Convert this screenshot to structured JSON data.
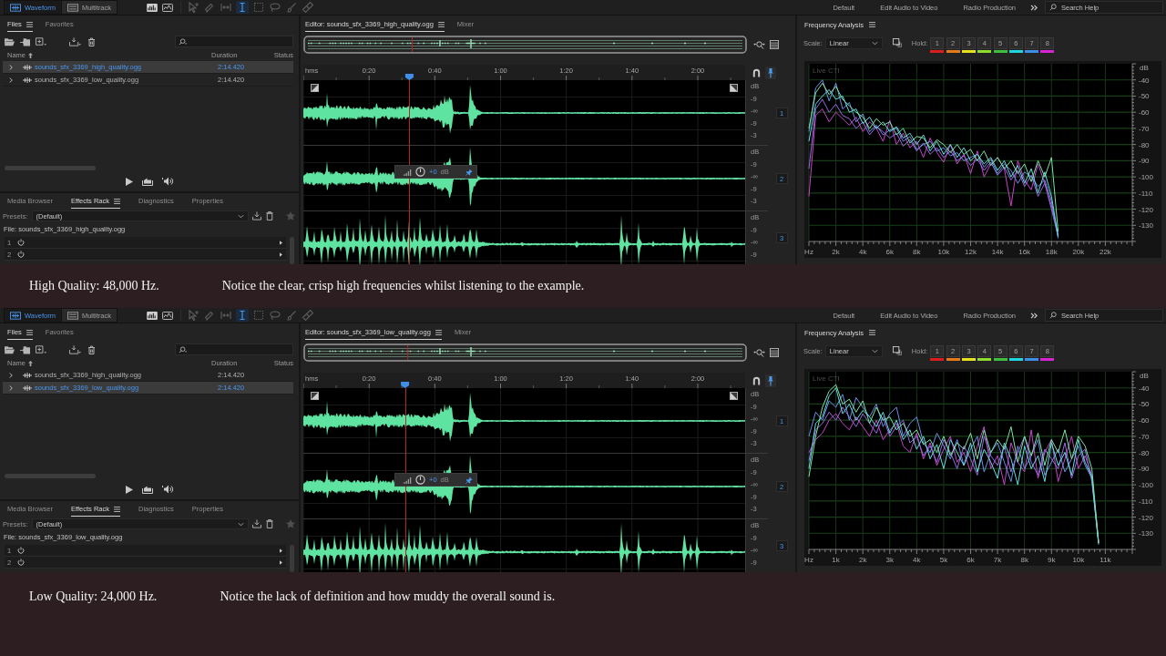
{
  "screens": [
    {
      "app_bar": {
        "modes": [
          {
            "label": "Waveform",
            "selected": true
          },
          {
            "label": "Multitrack",
            "selected": false
          }
        ],
        "tools": [
          {
            "kind": "move",
            "selected": false,
            "disabled": true
          },
          {
            "kind": "razor",
            "selected": false,
            "disabled": true
          },
          {
            "kind": "slip",
            "selected": false,
            "disabled": true
          },
          {
            "kind": "time",
            "selected": true,
            "disabled": false
          },
          {
            "kind": "marquee",
            "selected": false,
            "disabled": true
          },
          {
            "kind": "lasso",
            "selected": false,
            "disabled": true
          },
          {
            "kind": "brush",
            "selected": false,
            "disabled": true
          },
          {
            "kind": "heal",
            "selected": false,
            "disabled": true
          }
        ],
        "workspaces": [
          "Default",
          "Edit Audio to Video",
          "Radio Production"
        ],
        "search": {
          "placeholder": "Search Help"
        }
      },
      "files": {
        "tabs": [
          {
            "label": "Files",
            "selected": true
          },
          {
            "label": "Favorites",
            "selected": false
          }
        ],
        "columns": [
          "Name",
          "Duration",
          "Status"
        ],
        "rows": [
          {
            "name": "sounds_sfx_3369_high_quality.ogg",
            "duration": "2:14.420",
            "selected": true
          },
          {
            "name": "sounds_sfx_3369_low_quality.ogg",
            "duration": "2:14.420",
            "selected": false
          }
        ]
      },
      "effects": {
        "tabs": [
          {
            "label": "Media Browser",
            "selected": false
          },
          {
            "label": "Effects Rack",
            "selected": true
          },
          {
            "label": "Diagnostics",
            "selected": false
          },
          {
            "label": "Properties",
            "selected": false
          }
        ],
        "presets_label": "Presets:",
        "preset": "(Default)",
        "file": "File: sounds_sfx_3369_high_quality.ogg",
        "slots": [
          "1",
          "2"
        ]
      },
      "editor": {
        "tabs": [
          {
            "label": "Editor: sounds_sfx_3369_high_quality.ogg",
            "selected": true
          },
          {
            "label": "Mixer",
            "selected": false
          }
        ],
        "ruler": [
          "hms",
          "0:20",
          "0:40",
          "1:00",
          "1:20",
          "1:40",
          "2:00"
        ],
        "playhead": {
          "level": 0.24
        },
        "gain": {
          "value": "+0",
          "unit": "dB"
        },
        "channels": [
          {
            "scale": [
              "dB",
              "-9",
              "-∞",
              "-9",
              "-3"
            ],
            "number": "1"
          },
          {
            "scale": [
              "dB",
              "-9",
              "-∞",
              "-9",
              "-3"
            ],
            "number": "2"
          },
          {
            "scale": [
              "dB",
              "-9",
              "-∞",
              "-9"
            ],
            "number": "3"
          }
        ]
      },
      "frequency": {
        "title": "Frequency Analysis",
        "scale_label": "Scale:",
        "scale": "Linear",
        "hold_label": "Hold:",
        "holds": [
          {
            "label": "1",
            "color": "#d81e1e"
          },
          {
            "label": "2",
            "color": "#e57a1a"
          },
          {
            "label": "3",
            "color": "#e8e21e"
          },
          {
            "label": "4",
            "color": "#8edc2c"
          },
          {
            "label": "5",
            "color": "#3fbf3f"
          },
          {
            "label": "6",
            "color": "#1fd6e0"
          },
          {
            "label": "7",
            "color": "#3d8ee6"
          },
          {
            "label": "8",
            "color": "#d424d4"
          }
        ],
        "chart_data": [
          {
            "type": "line",
            "ylabel": "dB",
            "xlim": [
              0,
              24000
            ],
            "ylim": [
              -140,
              -30
            ],
            "xticks": [
              {
                "value": 0,
                "label": "Hz"
              },
              {
                "value": 2000,
                "label": "2k"
              },
              {
                "value": 4000,
                "label": "4k"
              },
              {
                "value": 6000,
                "label": "6k"
              },
              {
                "value": 8000,
                "label": "8k"
              },
              {
                "value": 10000,
                "label": "10k"
              },
              {
                "value": 12000,
                "label": "12k"
              },
              {
                "value": 14000,
                "label": "14k"
              },
              {
                "value": 16000,
                "label": "16k"
              },
              {
                "value": 18000,
                "label": "18k"
              },
              {
                "value": 20000,
                "label": "20k"
              },
              {
                "value": 22000,
                "label": "22k"
              }
            ],
            "yticks": [
              -40,
              -50,
              -60,
              -70,
              -80,
              -90,
              -100,
              -110,
              -120,
              -130
            ],
            "grid": true,
            "annotations": [
              "Live CTI"
            ],
            "x": [
              0,
              500,
              1000,
              1500,
              2000,
              2500,
              3000,
              3500,
              4000,
              4500,
              5000,
              5500,
              6000,
              6500,
              7000,
              7500,
              8000,
              8500,
              9000,
              9500,
              10000,
              10500,
              11000,
              11500,
              12000,
              12500,
              13000,
              13500,
              14000,
              14500,
              15000,
              15500,
              16000,
              16500,
              17000,
              17500,
              18000,
              18500
            ],
            "series": [
              {
                "color": "#c545c8",
                "values": [
                  -112,
                  -62,
                  -58,
                  -66,
                  -60,
                  -64,
                  -68,
                  -63,
                  -72,
                  -66,
                  -70,
                  -78,
                  -65,
                  -80,
                  -73,
                  -82,
                  -78,
                  -88,
                  -76,
                  -85,
                  -91,
                  -80,
                  -92,
                  -86,
                  -98,
                  -84,
                  -100,
                  -92,
                  -88,
                  -95,
                  -118,
                  -90,
                  -102,
                  -108,
                  -92,
                  -104,
                  -118,
                  -136
                ]
              },
              {
                "color": "#9a6ae6",
                "values": [
                  -95,
                  -58,
                  -52,
                  -60,
                  -55,
                  -62,
                  -64,
                  -70,
                  -66,
                  -74,
                  -69,
                  -72,
                  -76,
                  -73,
                  -81,
                  -77,
                  -84,
                  -79,
                  -86,
                  -82,
                  -88,
                  -84,
                  -90,
                  -87,
                  -93,
                  -89,
                  -96,
                  -91,
                  -99,
                  -94,
                  -102,
                  -96,
                  -106,
                  -99,
                  -112,
                  -104,
                  -120,
                  -137
                ]
              },
              {
                "color": "#6e8ee6",
                "values": [
                  -72,
                  -45,
                  -40,
                  -53,
                  -42,
                  -58,
                  -54,
                  -66,
                  -61,
                  -72,
                  -68,
                  -74,
                  -71,
                  -70,
                  -78,
                  -75,
                  -83,
                  -80,
                  -78,
                  -84,
                  -82,
                  -87,
                  -85,
                  -90,
                  -88,
                  -86,
                  -94,
                  -89,
                  -98,
                  -92,
                  -96,
                  -104,
                  -97,
                  -100,
                  -106,
                  -102,
                  -115,
                  -138
                ]
              },
              {
                "color": "#63dde3",
                "values": [
                  -78,
                  -55,
                  -50,
                  -46,
                  -52,
                  -50,
                  -60,
                  -58,
                  -67,
                  -63,
                  -70,
                  -66,
                  -72,
                  -69,
                  -76,
                  -73,
                  -80,
                  -74,
                  -84,
                  -78,
                  -86,
                  -80,
                  -88,
                  -82,
                  -90,
                  -86,
                  -92,
                  -88,
                  -96,
                  -90,
                  -100,
                  -93,
                  -104,
                  -95,
                  -110,
                  -97,
                  -112,
                  -137
                ]
              },
              {
                "color": "#7de3a6",
                "values": [
                  -70,
                  -48,
                  -42,
                  -49,
                  -44,
                  -52,
                  -56,
                  -60,
                  -63,
                  -70,
                  -64,
                  -68,
                  -66,
                  -74,
                  -70,
                  -79,
                  -75,
                  -76,
                  -82,
                  -77,
                  -80,
                  -85,
                  -80,
                  -86,
                  -83,
                  -90,
                  -84,
                  -93,
                  -88,
                  -95,
                  -90,
                  -98,
                  -92,
                  -103,
                  -90,
                  -100,
                  -88,
                  -134
                ]
              }
            ]
          }
        ]
      },
      "caption": {
        "title": "High Quality: 48,000 Hz.",
        "note": "Notice the clear, crisp high frequencies whilst listening to the example."
      }
    },
    {
      "app_bar": {
        "modes": [
          {
            "label": "Waveform",
            "selected": true
          },
          {
            "label": "Multitrack",
            "selected": false
          }
        ],
        "tools": [
          {
            "kind": "move",
            "selected": false,
            "disabled": true
          },
          {
            "kind": "razor",
            "selected": false,
            "disabled": true
          },
          {
            "kind": "slip",
            "selected": false,
            "disabled": true
          },
          {
            "kind": "time",
            "selected": true,
            "disabled": false
          },
          {
            "kind": "marquee",
            "selected": false,
            "disabled": true
          },
          {
            "kind": "lasso",
            "selected": false,
            "disabled": true
          },
          {
            "kind": "brush",
            "selected": false,
            "disabled": true
          },
          {
            "kind": "heal",
            "selected": false,
            "disabled": true
          }
        ],
        "workspaces": [
          "Default",
          "Edit Audio to Video",
          "Radio Production"
        ],
        "search": {
          "placeholder": "Search Help"
        }
      },
      "files": {
        "tabs": [
          {
            "label": "Files",
            "selected": true
          },
          {
            "label": "Favorites",
            "selected": false
          }
        ],
        "columns": [
          "Name",
          "Duration",
          "Status"
        ],
        "rows": [
          {
            "name": "sounds_sfx_3369_high_quality.ogg",
            "duration": "2:14.420",
            "selected": false
          },
          {
            "name": "sounds_sfx_3369_low_quality.ogg",
            "duration": "2:14.420",
            "selected": true
          }
        ]
      },
      "effects": {
        "tabs": [
          {
            "label": "Media Browser",
            "selected": false
          },
          {
            "label": "Effects Rack",
            "selected": true
          },
          {
            "label": "Diagnostics",
            "selected": false
          },
          {
            "label": "Properties",
            "selected": false
          }
        ],
        "presets_label": "Presets:",
        "preset": "(Default)",
        "file": "File: sounds_sfx_3369_low_quality.ogg",
        "slots": [
          "1",
          "2"
        ]
      },
      "editor": {
        "tabs": [
          {
            "label": "Editor: sounds_sfx_3369_low_quality.ogg",
            "selected": true
          },
          {
            "label": "Mixer",
            "selected": false
          }
        ],
        "ruler": [
          "hms",
          "0:20",
          "0:40",
          "1:00",
          "1:20",
          "1:40",
          "2:00"
        ],
        "playhead": {
          "level": 0.23
        },
        "gain": {
          "value": "+0",
          "unit": "dB"
        },
        "channels": [
          {
            "scale": [
              "dB",
              "-9",
              "-∞",
              "-9",
              "-3"
            ],
            "number": "1"
          },
          {
            "scale": [
              "dB",
              "-9",
              "-∞",
              "-9",
              "-3"
            ],
            "number": "2"
          },
          {
            "scale": [
              "dB",
              "-9",
              "-∞",
              "-9"
            ],
            "number": "3"
          }
        ]
      },
      "frequency": {
        "title": "Frequency Analysis",
        "scale_label": "Scale:",
        "scale": "Linear",
        "hold_label": "Hold:",
        "holds": [
          {
            "label": "1",
            "color": "#d81e1e"
          },
          {
            "label": "2",
            "color": "#e57a1a"
          },
          {
            "label": "3",
            "color": "#e8e21e"
          },
          {
            "label": "4",
            "color": "#8edc2c"
          },
          {
            "label": "5",
            "color": "#3fbf3f"
          },
          {
            "label": "6",
            "color": "#1fd6e0"
          },
          {
            "label": "7",
            "color": "#3d8ee6"
          },
          {
            "label": "8",
            "color": "#d424d4"
          }
        ],
        "chart_data": [
          {
            "type": "line",
            "ylabel": "dB",
            "xlim": [
              0,
              12000
            ],
            "ylim": [
              -140,
              -30
            ],
            "xticks": [
              {
                "value": 0,
                "label": "Hz"
              },
              {
                "value": 1000,
                "label": "1k"
              },
              {
                "value": 2000,
                "label": "2k"
              },
              {
                "value": 3000,
                "label": "3k"
              },
              {
                "value": 4000,
                "label": "4k"
              },
              {
                "value": 5000,
                "label": "5k"
              },
              {
                "value": 6000,
                "label": "6k"
              },
              {
                "value": 7000,
                "label": "7k"
              },
              {
                "value": 8000,
                "label": "8k"
              },
              {
                "value": 9000,
                "label": "9k"
              },
              {
                "value": 10000,
                "label": "10k"
              },
              {
                "value": 11000,
                "label": "11k"
              }
            ],
            "yticks": [
              -40,
              -50,
              -60,
              -70,
              -80,
              -90,
              -100,
              -110,
              -120,
              -130
            ],
            "grid": true,
            "annotations": [
              "Live CTI"
            ],
            "x": [
              0,
              250,
              500,
              750,
              1000,
              1250,
              1500,
              1750,
              2000,
              2250,
              2500,
              2750,
              3000,
              3250,
              3500,
              3750,
              4000,
              4250,
              4500,
              4750,
              5000,
              5250,
              5500,
              5750,
              6000,
              6250,
              6500,
              6750,
              7000,
              7250,
              7500,
              7750,
              8000,
              8250,
              8500,
              8750,
              9000,
              9250,
              9500,
              9750,
              10000,
              10250,
              10500,
              10750
            ],
            "series": [
              {
                "color": "#c545c8",
                "values": [
                  -80,
                  -72,
                  -68,
                  -60,
                  -56,
                  -62,
                  -66,
                  -58,
                  -64,
                  -70,
                  -60,
                  -72,
                  -66,
                  -62,
                  -76,
                  -80,
                  -68,
                  -84,
                  -74,
                  -88,
                  -78,
                  -70,
                  -86,
                  -80,
                  -92,
                  -76,
                  -64,
                  -90,
                  -82,
                  -100,
                  -74,
                  -86,
                  -92,
                  -66,
                  -96,
                  -80,
                  -72,
                  -98,
                  -84,
                  -70,
                  -90,
                  -82,
                  -94,
                  -135
                ]
              },
              {
                "color": "#9a6ae6",
                "values": [
                  -85,
                  -66,
                  -62,
                  -55,
                  -60,
                  -52,
                  -58,
                  -64,
                  -56,
                  -62,
                  -68,
                  -58,
                  -70,
                  -64,
                  -60,
                  -74,
                  -70,
                  -82,
                  -76,
                  -86,
                  -72,
                  -80,
                  -90,
                  -76,
                  -84,
                  -94,
                  -70,
                  -82,
                  -88,
                  -76,
                  -92,
                  -80,
                  -70,
                  -86,
                  -94,
                  -78,
                  -84,
                  -90,
                  -74,
                  -96,
                  -82,
                  -78,
                  -98,
                  -136
                ]
              },
              {
                "color": "#6e8ee6",
                "values": [
                  -70,
                  -55,
                  -60,
                  -48,
                  -52,
                  -44,
                  -60,
                  -46,
                  -52,
                  -58,
                  -50,
                  -64,
                  -56,
                  -52,
                  -70,
                  -62,
                  -58,
                  -74,
                  -80,
                  -68,
                  -76,
                  -84,
                  -72,
                  -88,
                  -78,
                  -70,
                  -92,
                  -80,
                  -74,
                  -86,
                  -98,
                  -76,
                  -90,
                  -82,
                  -72,
                  -94,
                  -86,
                  -78,
                  -92,
                  -84,
                  -76,
                  -88,
                  -96,
                  -136
                ]
              },
              {
                "color": "#63dde3",
                "values": [
                  -90,
                  -62,
                  -58,
                  -45,
                  -40,
                  -56,
                  -50,
                  -60,
                  -54,
                  -58,
                  -64,
                  -55,
                  -68,
                  -60,
                  -72,
                  -66,
                  -78,
                  -70,
                  -84,
                  -75,
                  -90,
                  -72,
                  -80,
                  -88,
                  -74,
                  -92,
                  -78,
                  -86,
                  -96,
                  -74,
                  -84,
                  -100,
                  -76,
                  -90,
                  -82,
                  -98,
                  -74,
                  -88,
                  -80,
                  -94,
                  -72,
                  -86,
                  -95,
                  -137
                ]
              },
              {
                "color": "#7de3a6",
                "values": [
                  -95,
                  -70,
                  -52,
                  -42,
                  -38,
                  -50,
                  -47,
                  -55,
                  -48,
                  -62,
                  -52,
                  -60,
                  -58,
                  -66,
                  -62,
                  -70,
                  -66,
                  -75,
                  -72,
                  -80,
                  -70,
                  -82,
                  -74,
                  -78,
                  -68,
                  -84,
                  -66,
                  -80,
                  -72,
                  -78,
                  -64,
                  -86,
                  -70,
                  -82,
                  -68,
                  -88,
                  -72,
                  -80,
                  -66,
                  -84,
                  -70,
                  -76,
                  -90,
                  -136
                ]
              }
            ]
          }
        ]
      },
      "caption": {
        "title": "Low Quality: 24,000 Hz.",
        "note": "Notice the lack of definition and how muddy the overall sound is."
      }
    }
  ]
}
